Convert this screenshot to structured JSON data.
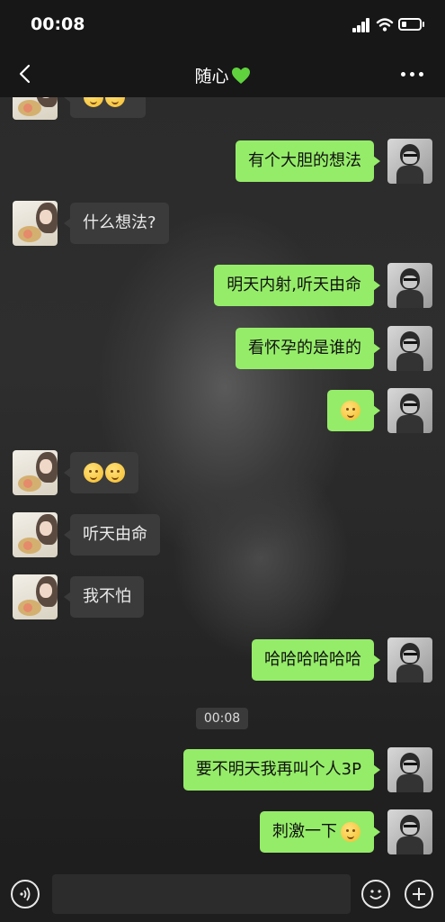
{
  "status_bar": {
    "time": "00:08"
  },
  "header": {
    "contact_name": "随心",
    "back_icon": "chevron-left-icon",
    "heart_icon": "green-heart-icon",
    "more_icon": "more-icon"
  },
  "messages": [
    {
      "sender": "them",
      "text": ""
    },
    {
      "sender": "me",
      "text": "有个大胆的想法"
    },
    {
      "sender": "them",
      "text": "什么想法?"
    },
    {
      "sender": "me",
      "text": "明天内‌射,听天由命"
    },
    {
      "sender": "me",
      "text": "看怀孕的是谁的"
    },
    {
      "sender": "me",
      "text": "",
      "emoji": "smile-emoji"
    },
    {
      "sender": "them",
      "text": "",
      "emoji": "laugh-emoji"
    },
    {
      "sender": "them",
      "text": "听天由命"
    },
    {
      "sender": "them",
      "text": "我不怕"
    },
    {
      "sender": "me",
      "text": "哈哈哈哈哈哈"
    },
    {
      "sender": "me",
      "text": "要不明天我再叫个人3P"
    },
    {
      "sender": "me",
      "text": "刺激一下",
      "emoji": "smile-emoji"
    }
  ],
  "timestamp": "00:08",
  "input_bar": {
    "voice_icon": "voice-icon",
    "emoji_icon": "emoji-icon",
    "plus_icon": "plus-icon",
    "input_value": ""
  },
  "colors": {
    "outgoing_bubble": "#95ec69",
    "incoming_bubble": "#3b3b3b",
    "bar_bg": "#171717"
  }
}
